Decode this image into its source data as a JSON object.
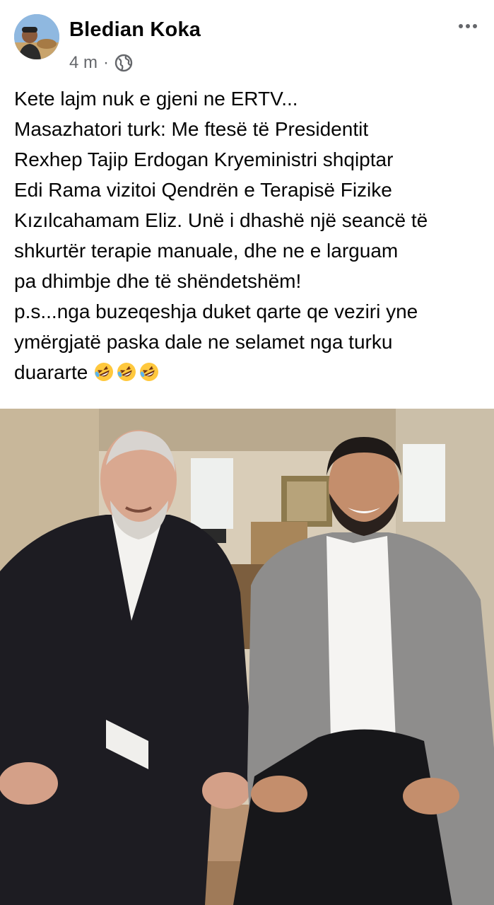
{
  "post": {
    "author": "Bledian Koka",
    "time": "4 m",
    "separator": "·",
    "privacy_icon": "globe-icon",
    "more_icon": "more-horizontal-icon",
    "text_lines": [
      "Kete lajm nuk e gjeni ne ERTV...",
      "Masazhatori turk: Me ftesë të Presidentit",
      "Rexhep Tajip Erdogan Kryeministri shqiptar",
      "Edi Rama vizitoi Qendrën e Terapisë Fizike",
      "Kızılcahamam Eliz. Unë i dhashë një seancë të",
      "shkurtër terapie manuale, dhe ne e larguam",
      "pa dhimbje dhe të shëndetshëm!",
      "p.s...nga buzeqeshja duket qarte qe veziri yne",
      "ymërgjatë paska dale ne selamet nga turku",
      "duararte"
    ],
    "emoji_icons": [
      "rolling-on-floor-laughing-icon",
      "rolling-on-floor-laughing-icon",
      "rolling-on-floor-laughing-icon"
    ]
  },
  "colors": {
    "text": "#050505",
    "secondary_text": "#65676b",
    "background": "#ffffff"
  }
}
